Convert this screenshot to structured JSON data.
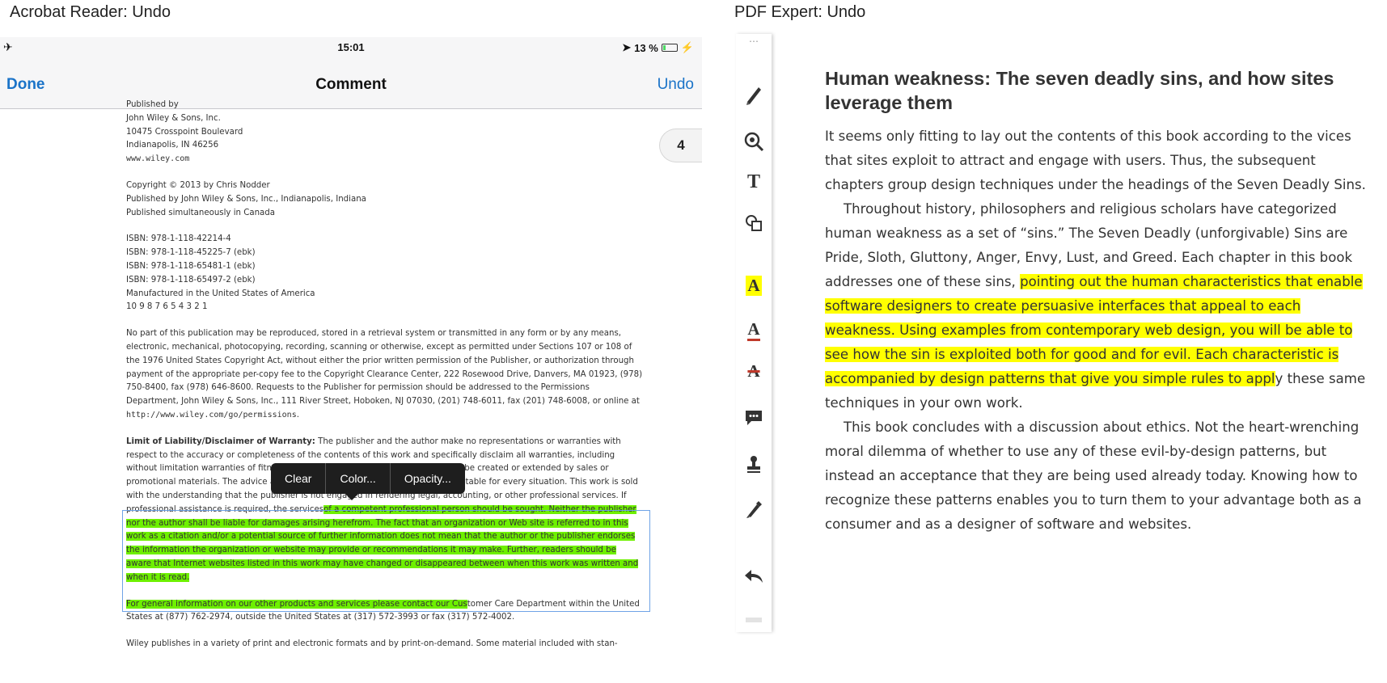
{
  "captions": {
    "left": "Acrobat Reader: Undo",
    "right": "PDF Expert: Undo"
  },
  "acrobat": {
    "status": {
      "time": "15:01",
      "battery": "13 %"
    },
    "nav": {
      "done": "Done",
      "title": "Comment",
      "undo": "Undo"
    },
    "page_badge": "4",
    "doc": {
      "lines1": [
        "Published by",
        "John Wiley & Sons, Inc.",
        "10475 Crosspoint Boulevard",
        "Indianapolis, IN 46256"
      ],
      "website": "www.wiley.com",
      "lines2": [
        "Copyright © 2013 by Chris Nodder",
        "Published by John Wiley & Sons, Inc., Indianapolis, Indiana",
        "Published simultaneously in Canada"
      ],
      "lines3": [
        "ISBN: 978-1-118-42214-4",
        "ISBN: 978-1-118-45225-7 (ebk)",
        "ISBN: 978-1-118-65481-1 (ebk)",
        "ISBN: 978-1-118-65497-2 (ebk)",
        "Manufactured in the United States of America",
        "10 9 8 7 6 5 4 3 2 1"
      ],
      "para1": "No part of this publication may be reproduced, stored in a retrieval system or transmitted in any form or by any means, electronic, mechanical, photocopying, recording, scanning or otherwise, except as permitted under Sections 107 or 108 of the 1976 United States Copyright Act, without either the prior written permission of the Publisher, or authorization through payment of the appropriate per-copy fee to the Copyright Clearance Center, 222 Rosewood Drive, Danvers, MA 01923, (978) 750-8400, fax (978) 646-8600. Requests to the Publisher for permission should be addressed to the Permissions Department, John Wiley & Sons, Inc., 111 River Street, Hoboken, NJ  07030, (201) 748-6011, fax (201) 748-6008, or online at",
      "para1_url": "http://www.wiley.com/go/permissions",
      "liability_title": "Limit of Liability/Disclaimer of Warranty:",
      "liability_plain": "The publisher and the author make no representations or warranties with respect to the accuracy or completeness of the contents of this work and specifically disclaim all warranties, including without limitation warranties of fitness for a particular purpose. No warranty may be created or extended by sales or promotional materials. The advice and strategies contained herein may not be suitable for every situation. This work is sold with the understanding that the publisher is not engaged in rendering legal, accounting, or other professional services. If professional assistance is required, the services",
      "liability_hl": "of a competent professional person should be sought. Neither the publisher nor the author shall be liable for damages arising herefrom. The fact that an organization or Web site is referred to in this work as a citation and/or a potential source of further information does not mean that the author or the publisher endorses the information the organization or website may provide or recommendations it may make. Further, readers should be aware that Internet websites listed in this work may have changed or disappeared between when this work was written and when it is read.",
      "general_hl": "For general information on our other products and services please contact our Cus",
      "general_plain": "tomer Care Department within the United States at (877) 762-2974, outside the United States at (317) 572-3993 or fax (317) 572-4002.",
      "wiley_line": "Wiley publishes in a variety of print and electronic formats and by print-on-demand. Some material included with stan-"
    },
    "popup": {
      "clear": "Clear",
      "color": "Color...",
      "opacity": "Opacity..."
    }
  },
  "pdfexpert": {
    "tools": [
      "pencil-icon",
      "zoom-icon",
      "text-icon",
      "shapes-icon",
      "highlight-icon",
      "underline-icon",
      "strikethrough-icon",
      "comment-icon",
      "stamp-icon",
      "signature-icon",
      "undo-icon"
    ],
    "tool_glyphs": {
      "text": "T",
      "highlight": "A",
      "underline": "A",
      "strike": "A"
    },
    "highlight_color": "#ffff00",
    "heading": "Human weakness: The seven deadly sins, and how sites leverage them",
    "p1": "It seems only fitting to lay out the contents of this book according to the vices that sites exploit to attract and engage with users. Thus, the subsequent chapters group design techniques under the headings of the Seven Deadly Sins.",
    "p2_plain": "Throughout history, philosophers and religious scholars have categorized human weakness as a set of “sins.” The Seven Deadly (unforgivable) Sins are Pride, Sloth, Gluttony, Anger, Envy, Lust, and Greed. Each chapter in this book addresses one of these sins,",
    "p2_hl": "pointing out the human characteristics that enable software designers to create persuasive interfaces that appeal to each weakness. Using examples from contemporary web design, you will be able to see how the sin is exploited both for good and for evil. Each characteristic is accompanied by design patterns that give you simple rules to appl",
    "p2_tail": "y these same techniques in your own work.",
    "p3": "This book concludes with a discussion about ethics. Not the heart-wrenching moral dilemma of whether to use any of these evil-by-design patterns, but instead an acceptance that they are being used already today. Knowing how to recognize these patterns enables you to turn them to your advantage both as a consumer and as a designer of software and websites."
  }
}
